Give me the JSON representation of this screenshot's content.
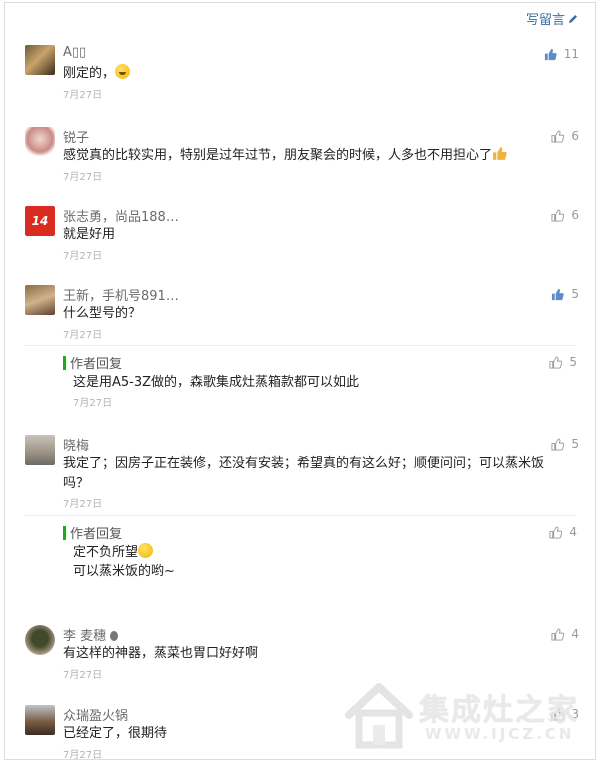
{
  "header": {
    "write_label": "写留言"
  },
  "comments": [
    {
      "name": "A▯▯",
      "text": "刚定的，",
      "date": "7月27日",
      "likes": "11",
      "liked": true
    },
    {
      "name": "锐子",
      "text": "感觉真的比较实用，特别是过年过节，朋友聚会的时候，人多也不用担心了",
      "date": "7月27日",
      "likes": "6",
      "liked": false
    },
    {
      "name": "张志勇，尚品188…",
      "text": "就是好用",
      "date": "7月27日",
      "likes": "6",
      "liked": false,
      "avatar_text": "14"
    },
    {
      "name": "王新，手机号891…",
      "text": "什么型号的？",
      "date": "7月27日",
      "likes": "5",
      "liked": true,
      "reply": {
        "title": "作者回复",
        "lines": [
          "这是用A5-3Z做的，森歌集成灶蒸箱款都可以如此"
        ],
        "date": "7月27日",
        "likes": "5"
      }
    },
    {
      "name": "晓梅",
      "text": "我定了；因房子正在装修，还没有安装；希望真的有这么好；顺便问问；可以蒸米饭吗？",
      "date": "7月27日",
      "likes": "5",
      "liked": false,
      "reply": {
        "title": "作者回复",
        "lines": [
          "定不负所望",
          "可以蒸米饭的哟~"
        ],
        "date": "",
        "likes": "4"
      }
    },
    {
      "name": "李 麦穗",
      "text": "有这样的神器，蒸菜也胃口好好啊",
      "date": "7月27日",
      "likes": "4",
      "liked": false
    },
    {
      "name": "众瑞盈火锅",
      "text": "已经定了，很期待",
      "date": "7月27日",
      "likes": "3",
      "liked": false
    }
  ],
  "watermark": {
    "title": "集成灶之家",
    "url": "WWW.IJCZ.CN"
  },
  "colors": {
    "link": "#3a6ea5",
    "like_active": "#5b8ec9",
    "reply_bar": "#1aad19"
  }
}
